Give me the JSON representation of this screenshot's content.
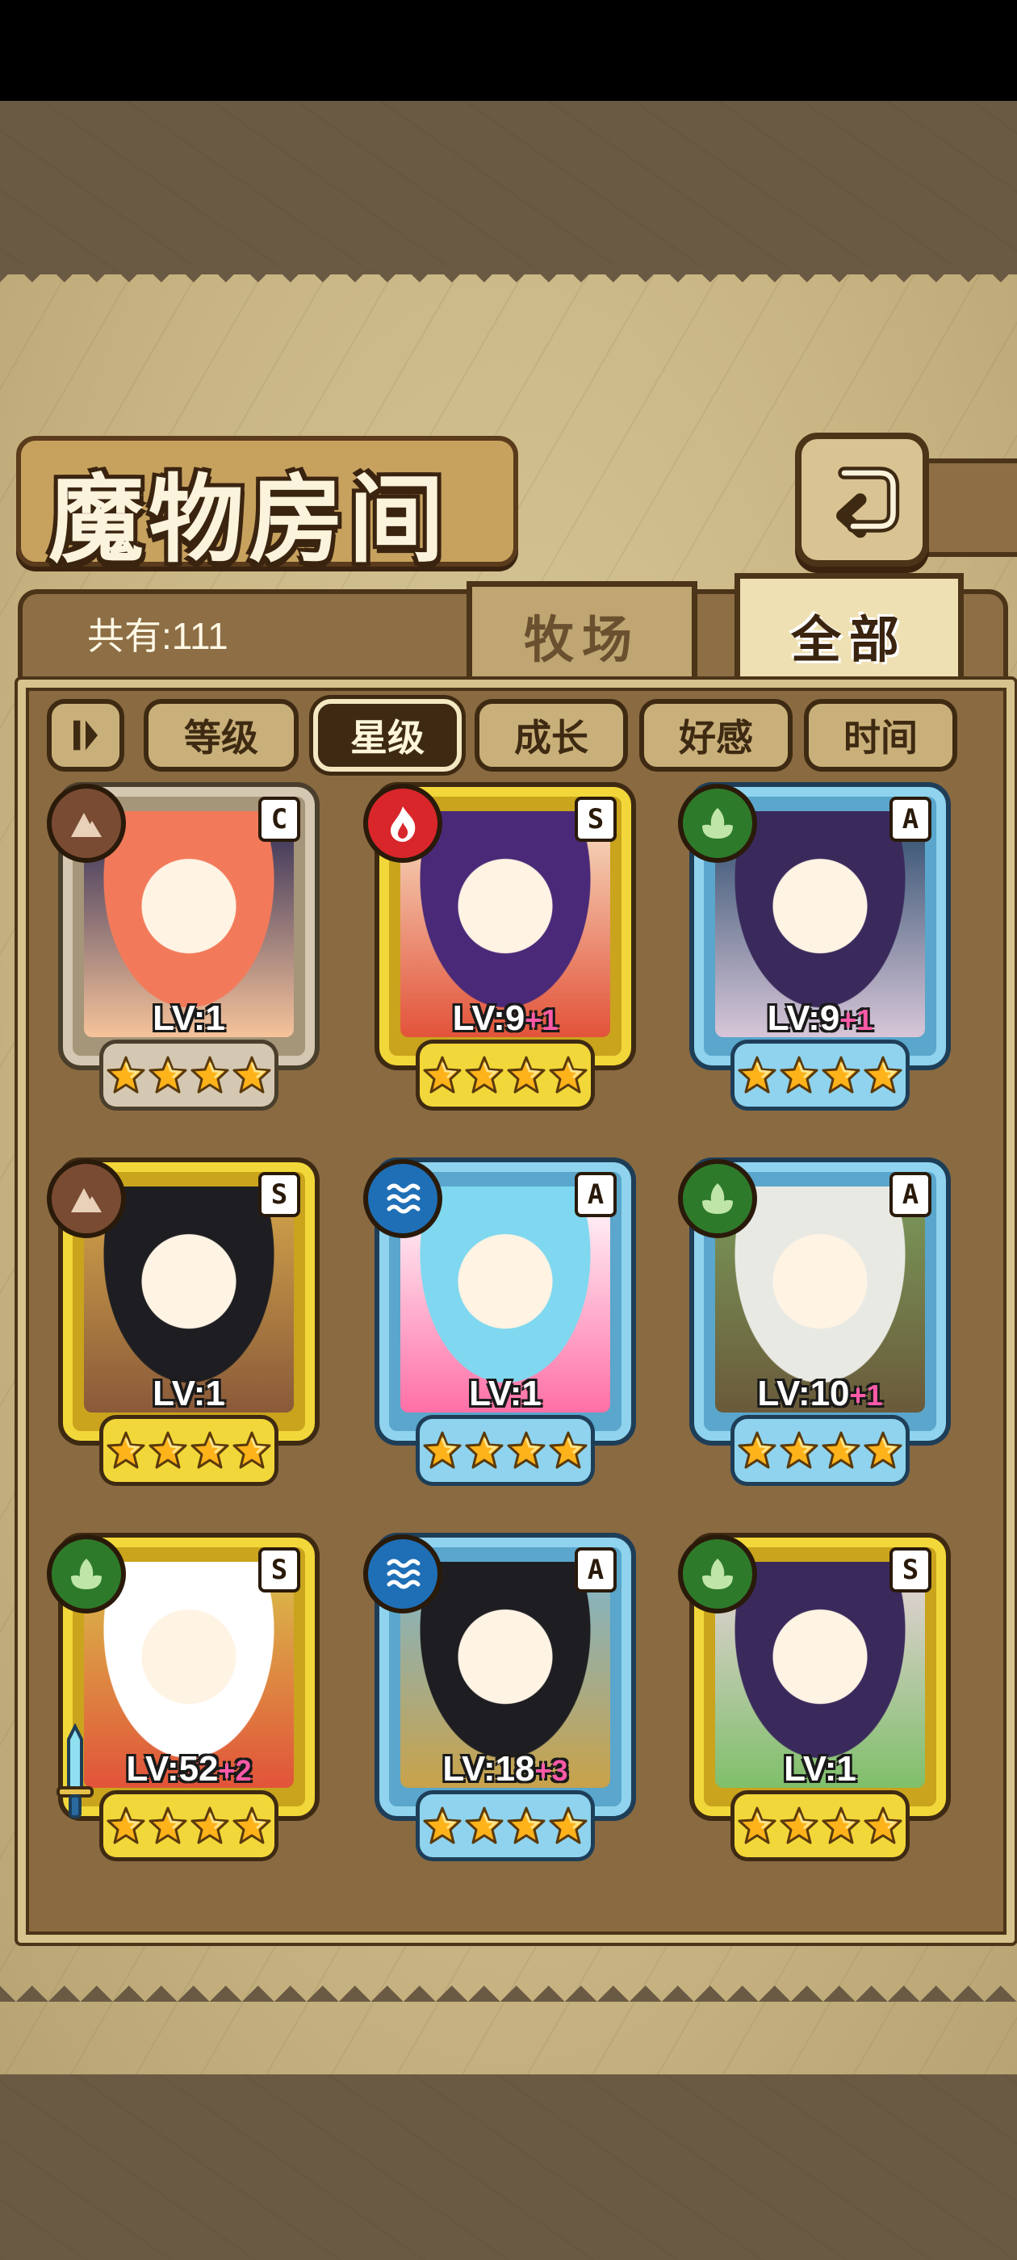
{
  "screen": {
    "title": "魔物房间",
    "count_label": "共有:111",
    "tabs": [
      {
        "label": "牧场",
        "active": false
      },
      {
        "label": "全部",
        "active": true
      }
    ],
    "sort_buttons": [
      {
        "label": "等级",
        "active": false
      },
      {
        "label": "星级",
        "active": true
      },
      {
        "label": "成长",
        "active": false
      },
      {
        "label": "好感",
        "active": false
      },
      {
        "label": "时间",
        "active": false
      }
    ],
    "icons": {
      "back": "return-arrow-icon",
      "sort_toggle": "sort-order-toggle-icon"
    }
  },
  "monsters": [
    {
      "rank": "C",
      "element": "earth",
      "level": "LV:1",
      "bonus": "",
      "stars": 4,
      "name_hidden": true,
      "palette": [
        "#f27a5a",
        "#f6c39a",
        "#2d2a55"
      ]
    },
    {
      "rank": "S",
      "element": "fire",
      "level": "LV:9",
      "bonus": "+1",
      "stars": 4,
      "palette": [
        "#4a2a78",
        "#e2533a",
        "#f7e0c4"
      ]
    },
    {
      "rank": "A",
      "element": "wood",
      "level": "LV:9",
      "bonus": "+1",
      "stars": 4,
      "palette": [
        "#3a2a5c",
        "#d7c6d8",
        "#2a4a6c"
      ]
    },
    {
      "rank": "S",
      "element": "earth",
      "level": "LV:1",
      "bonus": "",
      "stars": 4,
      "palette": [
        "#1e1e22",
        "#8a5a3a",
        "#d4a54a"
      ]
    },
    {
      "rank": "A",
      "element": "water",
      "level": "LV:1",
      "bonus": "",
      "stars": 4,
      "palette": [
        "#7fd8ef",
        "#ff6fa6",
        "#ffffff"
      ]
    },
    {
      "rank": "A",
      "element": "wood",
      "level": "LV:10",
      "bonus": "+1",
      "stars": 4,
      "palette": [
        "#e9e9e4",
        "#6a5a3a",
        "#7a9a5a"
      ]
    },
    {
      "rank": "S",
      "element": "wood",
      "level": "LV:52",
      "bonus": "+2",
      "stars": 4,
      "palette": [
        "#ffffff",
        "#e2533a",
        "#d9c04a"
      ]
    },
    {
      "rank": "A",
      "element": "water",
      "level": "LV:18",
      "bonus": "+3",
      "stars": 4,
      "palette": [
        "#1e1e22",
        "#c9a24a",
        "#7fb6ce"
      ]
    },
    {
      "rank": "S",
      "element": "wood",
      "level": "LV:1",
      "bonus": "",
      "stars": 4,
      "palette": [
        "#3a2a5c",
        "#7fbf6a",
        "#ead3dc"
      ]
    }
  ],
  "colors": {
    "rank_S": "#f2d73a",
    "rank_A": "#8fd3ee",
    "rank_C": "#d4c8b2",
    "plus": "#ff5aa8"
  }
}
